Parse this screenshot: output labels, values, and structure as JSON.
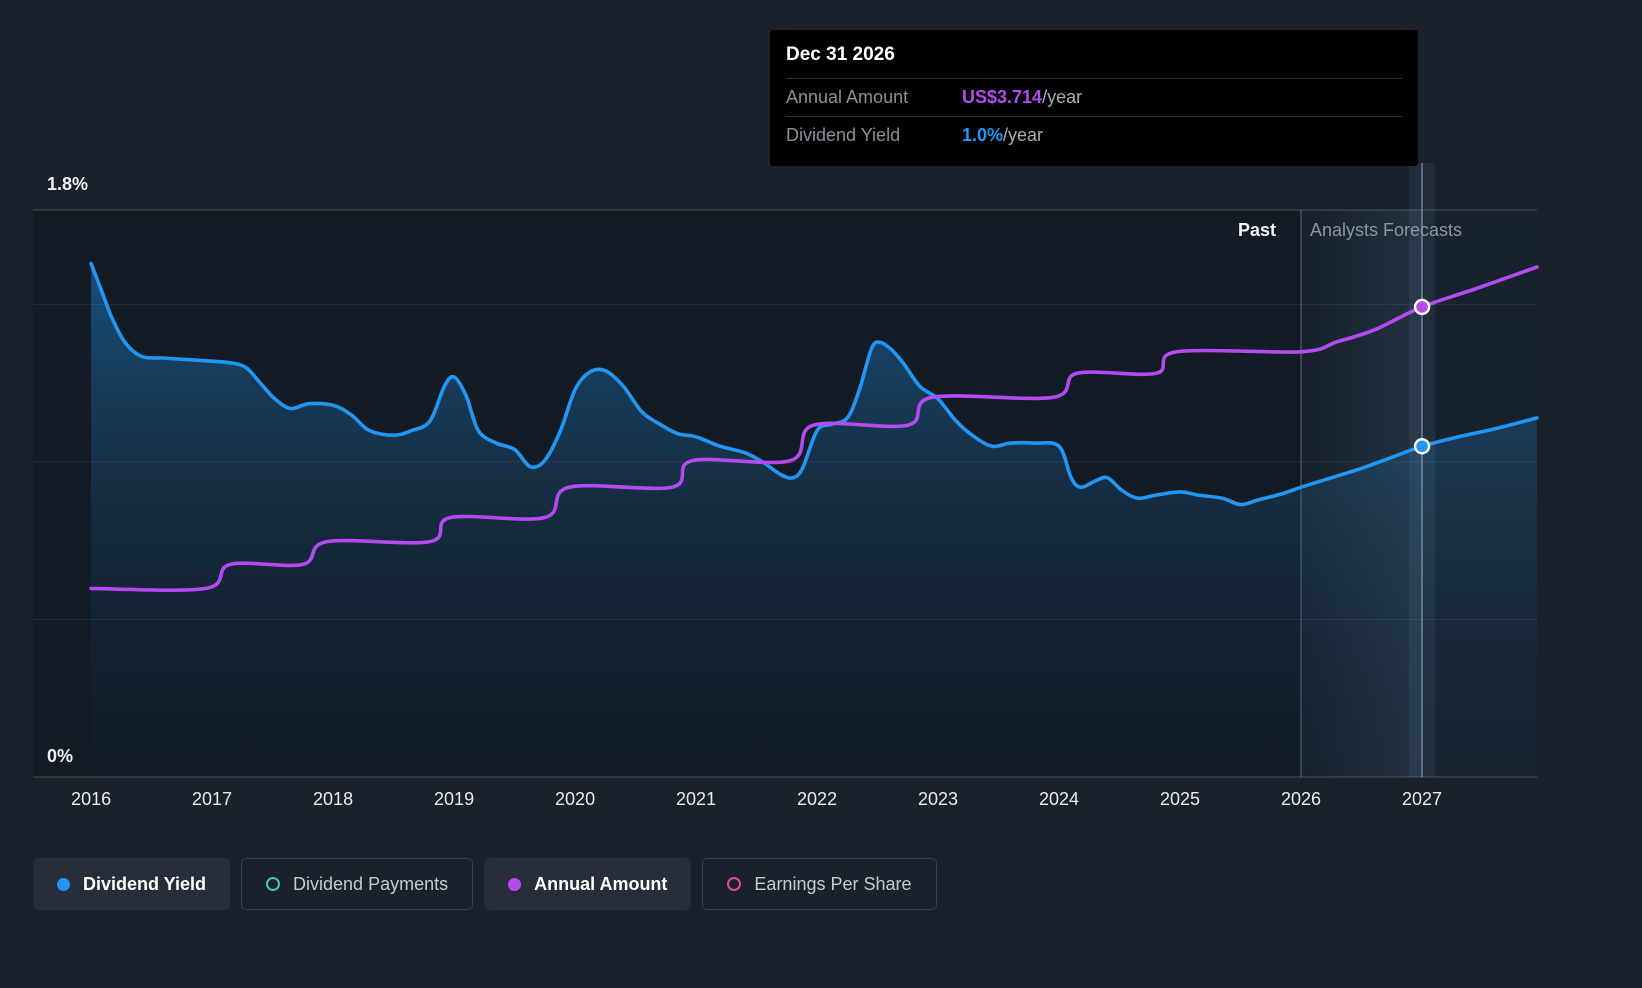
{
  "tooltip": {
    "date": "Dec 31 2026",
    "rows": [
      {
        "label": "Annual Amount",
        "value": "US$3.714",
        "suffix": "/year"
      },
      {
        "label": "Dividend Yield",
        "value": "1.0%",
        "suffix": "/year"
      }
    ]
  },
  "chart_data": {
    "type": "area",
    "past_label": "Past",
    "forecast_label": "Analysts Forecasts",
    "forecast_start": 2026,
    "hover": {
      "x": 2027
    },
    "x_range": [
      2015.52,
      2027.95
    ],
    "x_ticks": [
      2016,
      2017,
      2018,
      2019,
      2020,
      2021,
      2022,
      2023,
      2024,
      2025,
      2026,
      2027
    ],
    "y_axis": {
      "top_label": "1.8%",
      "bottom_label": "0%",
      "min": 0,
      "max": 1.8,
      "unit": "%",
      "gridlines": [
        0,
        0.5,
        1.0,
        1.5,
        1.8
      ]
    },
    "series": [
      {
        "name": "Dividend Yield",
        "unit": "%",
        "color": "#2196f3",
        "axis_max": 1.8,
        "area": true,
        "points": [
          [
            2016.0,
            1.63
          ],
          [
            2016.08,
            1.55
          ],
          [
            2016.17,
            1.46
          ],
          [
            2016.28,
            1.38
          ],
          [
            2016.42,
            1.335
          ],
          [
            2016.6,
            1.33
          ],
          [
            2016.8,
            1.325
          ],
          [
            2017.0,
            1.32
          ],
          [
            2017.15,
            1.315
          ],
          [
            2017.28,
            1.3
          ],
          [
            2017.4,
            1.25
          ],
          [
            2017.52,
            1.2
          ],
          [
            2017.65,
            1.17
          ],
          [
            2017.8,
            1.185
          ],
          [
            2018.0,
            1.18
          ],
          [
            2018.15,
            1.15
          ],
          [
            2018.3,
            1.1
          ],
          [
            2018.5,
            1.085
          ],
          [
            2018.65,
            1.1
          ],
          [
            2018.8,
            1.13
          ],
          [
            2018.92,
            1.24
          ],
          [
            2019.0,
            1.27
          ],
          [
            2019.1,
            1.21
          ],
          [
            2019.2,
            1.1
          ],
          [
            2019.35,
            1.06
          ],
          [
            2019.5,
            1.04
          ],
          [
            2019.63,
            0.985
          ],
          [
            2019.75,
            1.005
          ],
          [
            2019.88,
            1.1
          ],
          [
            2020.0,
            1.23
          ],
          [
            2020.12,
            1.285
          ],
          [
            2020.25,
            1.29
          ],
          [
            2020.4,
            1.24
          ],
          [
            2020.55,
            1.16
          ],
          [
            2020.7,
            1.12
          ],
          [
            2020.85,
            1.09
          ],
          [
            2021.0,
            1.08
          ],
          [
            2021.2,
            1.05
          ],
          [
            2021.4,
            1.03
          ],
          [
            2021.55,
            1.0
          ],
          [
            2021.7,
            0.96
          ],
          [
            2021.8,
            0.95
          ],
          [
            2021.88,
            0.98
          ],
          [
            2022.0,
            1.1
          ],
          [
            2022.12,
            1.12
          ],
          [
            2022.25,
            1.14
          ],
          [
            2022.35,
            1.23
          ],
          [
            2022.45,
            1.36
          ],
          [
            2022.52,
            1.38
          ],
          [
            2022.62,
            1.355
          ],
          [
            2022.72,
            1.31
          ],
          [
            2022.85,
            1.24
          ],
          [
            2023.0,
            1.2
          ],
          [
            2023.15,
            1.13
          ],
          [
            2023.3,
            1.08
          ],
          [
            2023.45,
            1.05
          ],
          [
            2023.6,
            1.06
          ],
          [
            2023.8,
            1.06
          ],
          [
            2024.0,
            1.05
          ],
          [
            2024.1,
            0.95
          ],
          [
            2024.18,
            0.92
          ],
          [
            2024.3,
            0.94
          ],
          [
            2024.4,
            0.95
          ],
          [
            2024.52,
            0.91
          ],
          [
            2024.65,
            0.885
          ],
          [
            2024.8,
            0.895
          ],
          [
            2025.0,
            0.905
          ],
          [
            2025.15,
            0.895
          ],
          [
            2025.35,
            0.885
          ],
          [
            2025.5,
            0.865
          ],
          [
            2025.65,
            0.88
          ],
          [
            2025.85,
            0.9
          ],
          [
            2026.0,
            0.92
          ],
          [
            2026.25,
            0.95
          ],
          [
            2026.5,
            0.98
          ],
          [
            2026.75,
            1.015
          ],
          [
            2027.0,
            1.05
          ],
          [
            2027.3,
            1.08
          ],
          [
            2027.6,
            1.105
          ],
          [
            2027.95,
            1.14
          ]
        ]
      },
      {
        "name": "Annual Amount",
        "unit": "US$/year",
        "color": "#b44bf0",
        "axis_max": 4.48,
        "area": false,
        "points": [
          [
            2016.0,
            1.49
          ],
          [
            2016.95,
            1.49
          ],
          [
            2017.15,
            1.68
          ],
          [
            2017.75,
            1.68
          ],
          [
            2017.95,
            1.86
          ],
          [
            2018.8,
            1.86
          ],
          [
            2018.97,
            2.05
          ],
          [
            2019.75,
            2.05
          ],
          [
            2019.95,
            2.29
          ],
          [
            2020.8,
            2.29
          ],
          [
            2020.97,
            2.5
          ],
          [
            2021.78,
            2.5
          ],
          [
            2021.97,
            2.78
          ],
          [
            2022.75,
            2.78
          ],
          [
            2022.95,
            3.0
          ],
          [
            2023.95,
            3.0
          ],
          [
            2024.15,
            3.19
          ],
          [
            2024.8,
            3.19
          ],
          [
            2024.97,
            3.36
          ],
          [
            2026.0,
            3.36
          ],
          [
            2026.3,
            3.44
          ],
          [
            2026.6,
            3.53
          ],
          [
            2027.0,
            3.714
          ],
          [
            2027.45,
            3.86
          ],
          [
            2027.95,
            4.03
          ]
        ]
      }
    ],
    "legend": [
      {
        "label": "Dividend Yield",
        "color": "#2196f3",
        "style": "filled"
      },
      {
        "label": "Dividend Payments",
        "color": "#45c4ae",
        "style": "outline"
      },
      {
        "label": "Annual Amount",
        "color": "#b44bf0",
        "style": "filled"
      },
      {
        "label": "Earnings Per Share",
        "color": "#e0479e",
        "style": "outline"
      }
    ]
  }
}
